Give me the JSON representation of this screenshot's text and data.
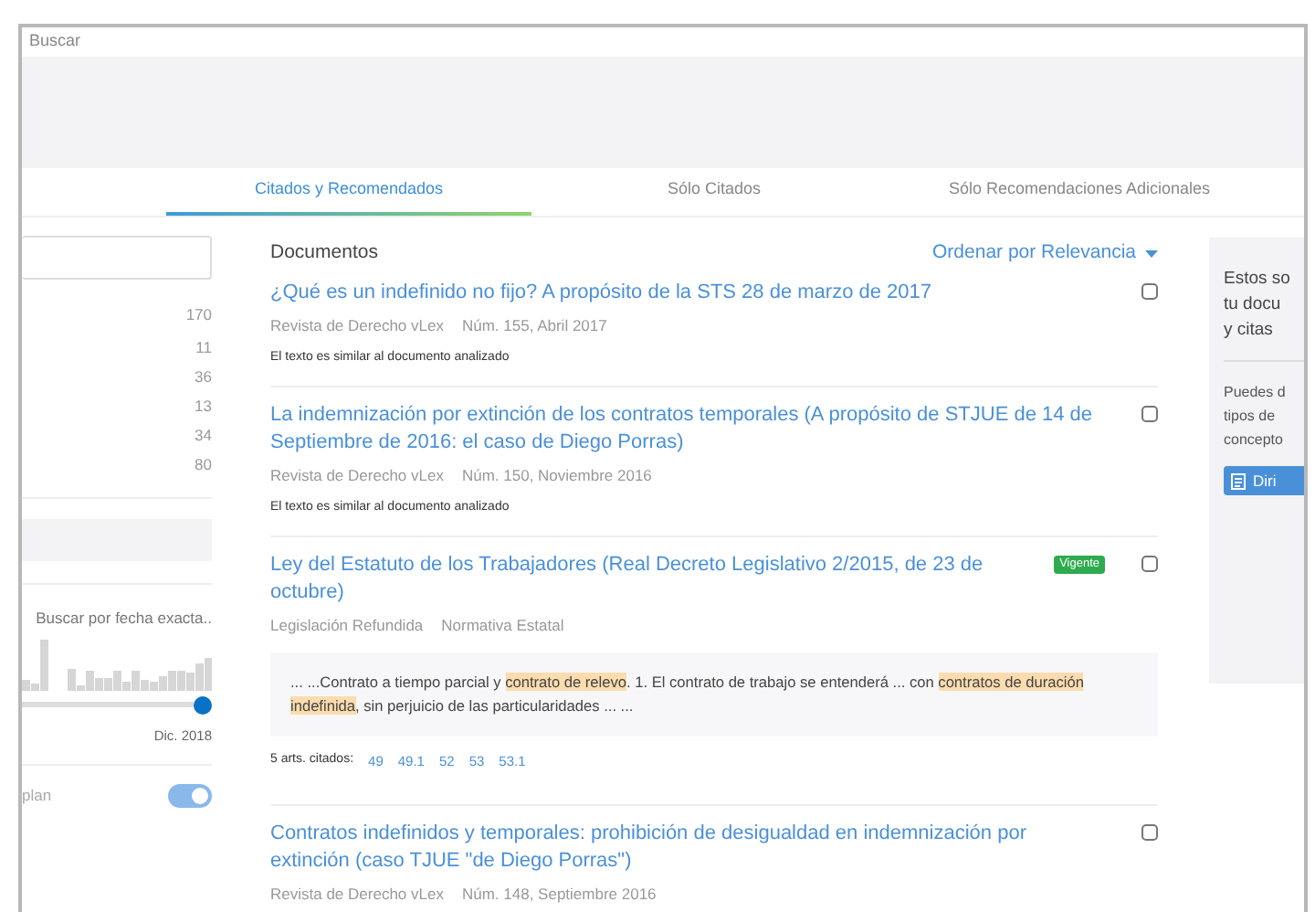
{
  "search_label": "Buscar",
  "tabs": [
    {
      "label": "Citados y Recomendados",
      "selected": true
    },
    {
      "label": "Sólo Citados",
      "selected": false
    },
    {
      "label": "Sólo Recomendaciones Adicionales",
      "selected": false
    }
  ],
  "sidebar": {
    "counts": [
      "170",
      "11",
      "36",
      "13",
      "34",
      "80"
    ],
    "date_search": "Buscar por fecha exacta..",
    "date_end": "Dic. 2018",
    "date_slider": {
      "level": 1
    },
    "toggle": {
      "label": "plan",
      "on": true
    }
  },
  "documents_heading": "Documentos",
  "sort": "Ordenar por Relevancia",
  "documents": [
    {
      "title": "¿Qué es un indefinido no fijo? A propósito de la STS 28 de marzo de 2017",
      "checked": false,
      "meta": [
        "Revista de Derecho vLex",
        "Núm. 155, Abril 2017"
      ],
      "note": "El texto es similar al documento analizado"
    },
    {
      "title": "La indemnización por extinción de los contratos temporales (A propósito de STJUE de 14 de Septiembre de 2016: el caso de Diego Porras)",
      "checked": false,
      "meta": [
        "Revista de Derecho vLex",
        "Núm. 150, Noviembre 2016"
      ],
      "note": "El texto es similar al documento analizado"
    },
    {
      "title": "Ley del Estatuto de los Trabajadores (Real Decreto Legislativo 2/2015, de 23 de octubre)",
      "badge": "Vigente",
      "checked": false,
      "meta": [
        "Legislación Refundida",
        "Normativa Estatal"
      ],
      "snippet": [
        {
          "text": "... ...Contrato a tiempo parcial y ",
          "highlight": false
        },
        {
          "text": "contrato de relevo",
          "highlight": true
        },
        {
          "text": ". 1. El contrato de trabajo se entenderá ... con ",
          "highlight": false
        },
        {
          "text": "contratos de duración indefinida",
          "highlight": true
        },
        {
          "text": ", sin perjuicio de las particularidades ... ...",
          "highlight": false
        }
      ],
      "cited_label": "5 arts. citados:",
      "cited": [
        "49",
        "49.1",
        "52",
        "53",
        "53.1"
      ]
    },
    {
      "title": "Contratos indefinidos y temporales: prohibición de desigualdad en indemnización por extinción (caso TJUE \"de Diego Porras\")",
      "checked": false,
      "meta": [
        "Revista de Derecho vLex",
        "Núm. 148, Septiembre 2016"
      ]
    }
  ],
  "side_panel": {
    "intro": [
      "Estos so",
      "tu docu",
      "y citas"
    ],
    "help": [
      "Puedes d",
      "tipos de",
      "concepto"
    ],
    "button": "Diri"
  }
}
